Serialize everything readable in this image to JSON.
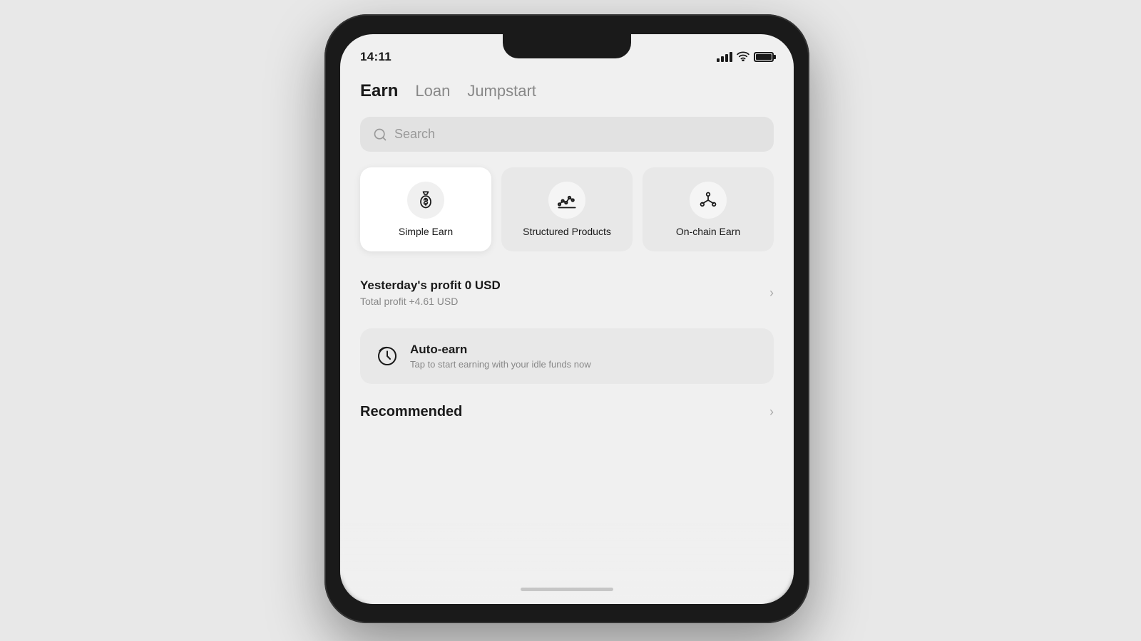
{
  "statusBar": {
    "time": "14:11",
    "battery": "full"
  },
  "navTabs": [
    {
      "id": "earn",
      "label": "Earn",
      "active": true
    },
    {
      "id": "loan",
      "label": "Loan",
      "active": false
    },
    {
      "id": "jumpstart",
      "label": "Jumpstart",
      "active": false
    }
  ],
  "search": {
    "placeholder": "Search"
  },
  "categoryCards": [
    {
      "id": "simple-earn",
      "label": "Simple Earn",
      "icon": "money-bag",
      "active": true
    },
    {
      "id": "structured-products",
      "label": "Structured Products",
      "icon": "structured",
      "active": false
    },
    {
      "id": "on-chain-earn",
      "label": "On-chain Earn",
      "icon": "network",
      "active": false
    }
  ],
  "profitSection": {
    "title": "Yesterday's profit 0 USD",
    "subtitle": "Total profit +4.61 USD"
  },
  "autoEarn": {
    "title": "Auto-earn",
    "subtitle": "Tap to start earning with your idle funds now"
  },
  "recommended": {
    "title": "Recommended",
    "chevron": "›"
  }
}
